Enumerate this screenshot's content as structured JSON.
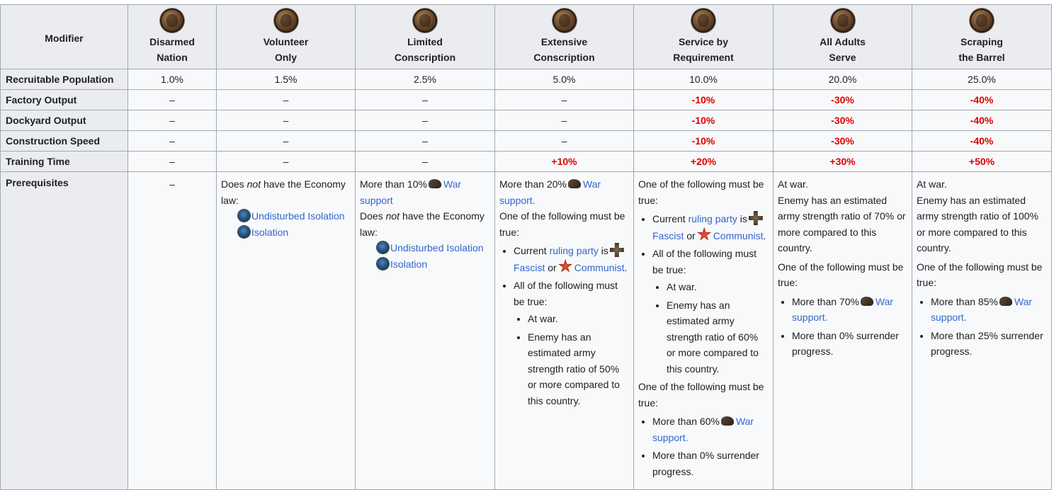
{
  "header": {
    "modifier_label": "Modifier",
    "laws": [
      {
        "line1": "Disarmed",
        "line2": "Nation",
        "icon": "disarmed-nation-icon"
      },
      {
        "line1": "Volunteer",
        "line2": "Only",
        "icon": "volunteer-only-icon"
      },
      {
        "line1": "Limited",
        "line2": "Conscription",
        "icon": "limited-conscription-icon"
      },
      {
        "line1": "Extensive",
        "line2": "Conscription",
        "icon": "extensive-conscription-icon"
      },
      {
        "line1": "Service by",
        "line2": "Requirement",
        "icon": "service-by-requirement-icon"
      },
      {
        "line1": "All Adults",
        "line2": "Serve",
        "icon": "all-adults-serve-icon"
      },
      {
        "line1": "Scraping",
        "line2": "the Barrel",
        "icon": "scraping-the-barrel-icon"
      }
    ]
  },
  "rows": [
    {
      "label": "Recruitable Population",
      "values": [
        "1.0%",
        "1.5%",
        "2.5%",
        "5.0%",
        "10.0%",
        "20.0%",
        "25.0%"
      ]
    },
    {
      "label": "Factory Output",
      "values": [
        "–",
        "–",
        "–",
        "–",
        "-10%",
        "-30%",
        "-40%"
      ]
    },
    {
      "label": "Dockyard Output",
      "values": [
        "–",
        "–",
        "–",
        "–",
        "-10%",
        "-30%",
        "-40%"
      ]
    },
    {
      "label": "Construction Speed",
      "values": [
        "–",
        "–",
        "–",
        "–",
        "-10%",
        "-30%",
        "-40%"
      ]
    },
    {
      "label": "Training Time",
      "values": [
        "–",
        "–",
        "–",
        "+10%",
        "+20%",
        "+30%",
        "+50%"
      ]
    }
  ],
  "colors": {
    "negative": "#dd0000",
    "link": "#3366cc",
    "header_bg": "#eaecf0",
    "cell_bg": "#f8f9fa",
    "border": "#a2a9b1"
  },
  "prereq": {
    "label": "Prerequisites",
    "disarmed": "–",
    "txt_more_than_10": "More than 10%",
    "txt_more_than_20": "More than 20%",
    "txt_more_than_60": "More than 60%",
    "txt_more_than_70": "More than 70%",
    "txt_more_than_85": "More than 85%",
    "war": "War",
    "support": "support",
    "period": ".",
    "does": "Does",
    "not": "not",
    "have_economy": "have the Economy",
    "law_colon": "law:",
    "undisturbed_isolation": "Undisturbed Isolation",
    "isolation": "Isolation",
    "one_of_following": "One of the following must be true:",
    "all_of_following": "All of the following must be true:",
    "current": "Current",
    "ruling_party": "ruling party",
    "is": "is",
    "fascist": "Fascist",
    "or": "or",
    "communist": "Communist",
    "at_war": "At war.",
    "enemy_50": "Enemy has an estimated army strength ratio of 50% or more compared to this country.",
    "enemy_60": "Enemy has an estimated army strength ratio of 60% or more compared to this country.",
    "enemy_70": "Enemy has an estimated army strength ratio of 70% or more compared to this country.",
    "enemy_100": "Enemy has an estimated army strength ratio of 100% or more compared to this country.",
    "surrender_0": "More than 0% surrender progress.",
    "surrender_25": "More than 25% surrender progress."
  }
}
